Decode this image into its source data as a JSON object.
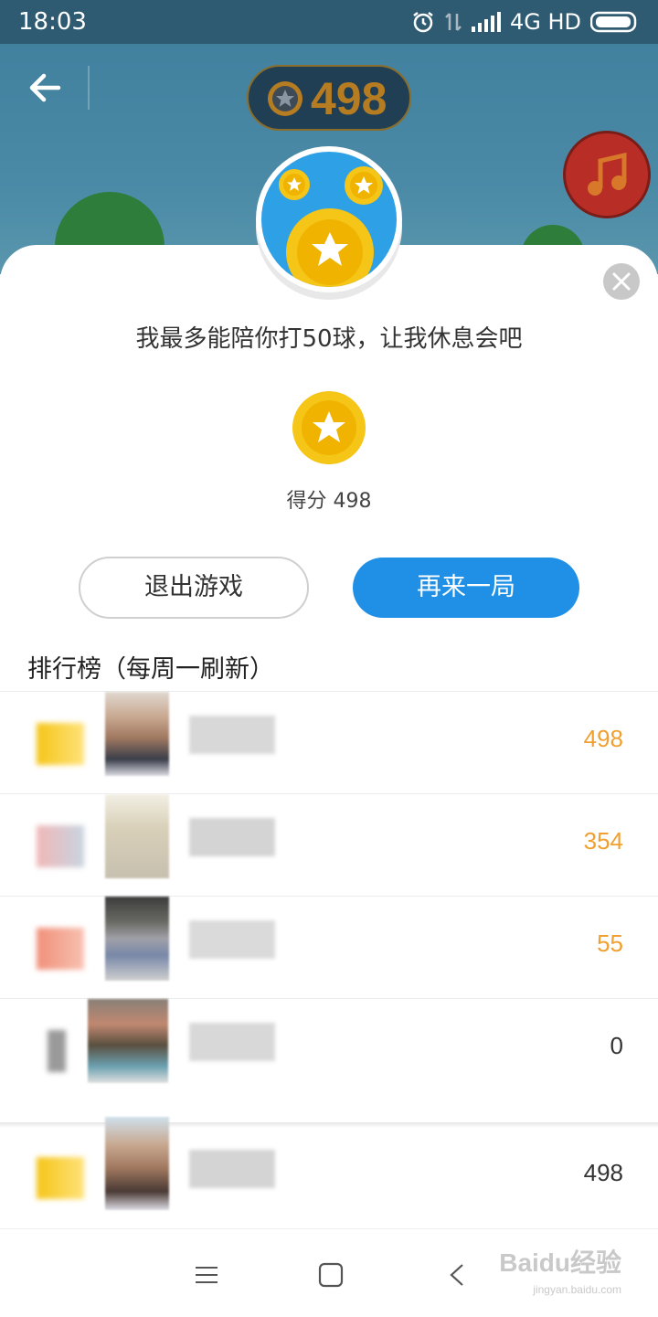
{
  "status_bar": {
    "time": "18:03",
    "network": "4G HD"
  },
  "header": {
    "coin_balance": "498"
  },
  "dialog": {
    "message": "我最多能陪你打50球，让我休息会吧",
    "score_label": "得分",
    "score_value": "498",
    "exit_button": "退出游戏",
    "again_button": "再来一局"
  },
  "leaderboard": {
    "title": "排行榜（每周一刷新）",
    "rows": [
      {
        "score": "498",
        "highlight": true
      },
      {
        "score": "354",
        "highlight": true
      },
      {
        "score": "55",
        "highlight": true
      },
      {
        "score": "0",
        "highlight": false
      }
    ],
    "my_row": {
      "score": "498"
    }
  },
  "watermark": {
    "text": "Baidu经验",
    "sub": "jingyan.baidu.com"
  },
  "colors": {
    "accent": "#1f90e6",
    "score_orange": "#f0a030",
    "coin": "#f5c518"
  },
  "icons": [
    "back-arrow-icon",
    "star-coin-icon",
    "music-note-icon",
    "close-icon",
    "menu-icon",
    "home-icon",
    "back-nav-icon"
  ]
}
